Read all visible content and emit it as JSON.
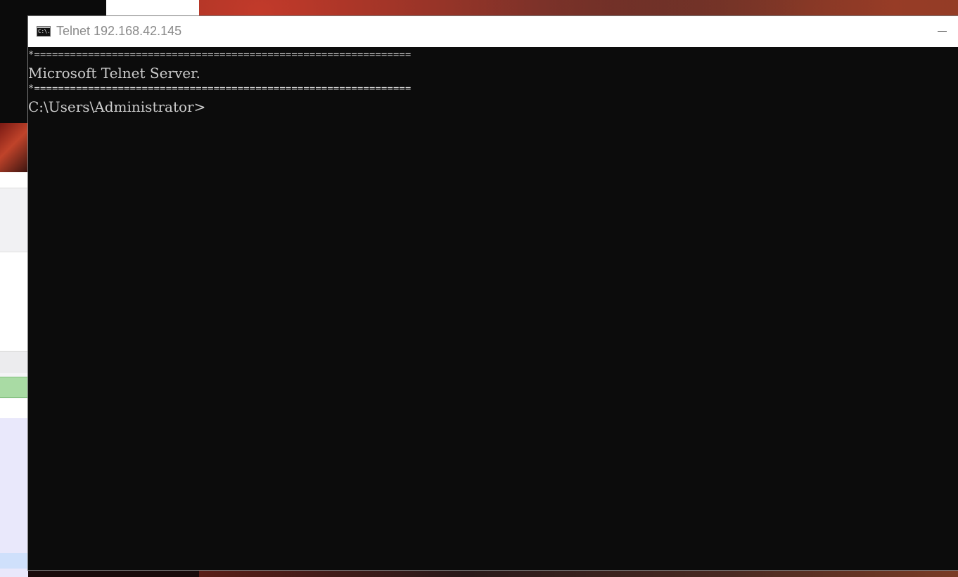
{
  "window": {
    "title": "Telnet 192.168.42.145",
    "icon": "command-prompt-icon",
    "icon_text": "C:\\."
  },
  "console": {
    "lines": [
      "*===============================================================",
      "Microsoft Telnet Server.",
      "*===============================================================",
      "C:\\Users\\Administrator>"
    ],
    "background_color": "#0c0c0c",
    "text_color": "#cccccc"
  }
}
